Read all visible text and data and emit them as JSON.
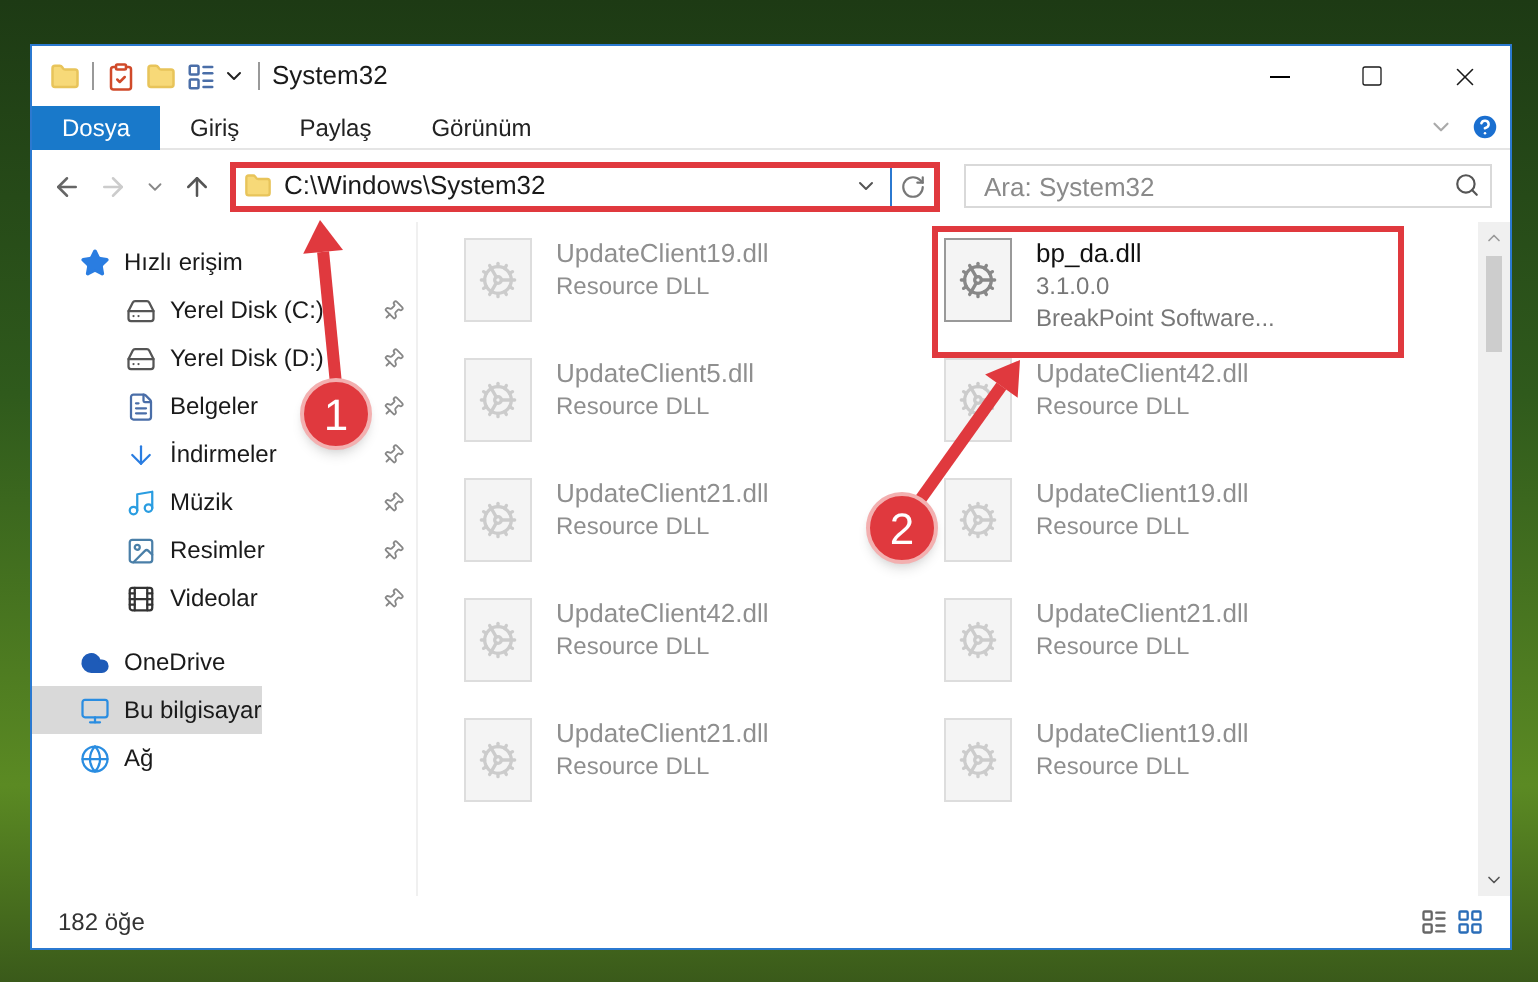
{
  "window": {
    "title": "System32"
  },
  "ribbon_tabs": [
    {
      "label": "Dosya",
      "selected": true
    },
    {
      "label": "Giriş",
      "selected": false
    },
    {
      "label": "Paylaş",
      "selected": false
    },
    {
      "label": "Görünüm",
      "selected": false
    }
  ],
  "address_bar": {
    "path": "C:\\Windows\\System32",
    "highlighted": true
  },
  "search": {
    "placeholder": "Ara: System32"
  },
  "sidebar": {
    "items": [
      {
        "label": "Hızlı erişim",
        "kind": "star",
        "selected": false,
        "children": [
          {
            "label": "Yerel Disk (C:)",
            "kind": "drive",
            "selected": false,
            "pinned": true
          },
          {
            "label": "Yerel Disk (D:)",
            "kind": "drive",
            "selected": false,
            "pinned": true
          },
          {
            "label": "Belgeler",
            "kind": "document",
            "selected": false,
            "pinned": true
          },
          {
            "label": "İndirmeler",
            "kind": "download",
            "selected": false,
            "pinned": true
          },
          {
            "label": "Müzik",
            "kind": "music",
            "selected": false,
            "pinned": true
          },
          {
            "label": "Resimler",
            "kind": "picture",
            "selected": false,
            "pinned": true
          },
          {
            "label": "Videolar",
            "kind": "video",
            "selected": false,
            "pinned": true
          }
        ]
      },
      {
        "label": "OneDrive",
        "kind": "cloud",
        "selected": false
      },
      {
        "label": "Bu bilgisayar",
        "kind": "computer",
        "selected": true
      },
      {
        "label": "Ağ",
        "kind": "network",
        "selected": false
      }
    ]
  },
  "files": [
    {
      "name": "UpdateClient19.dll",
      "details": [
        "Resource DLL"
      ],
      "blurred": true,
      "highlighted": false
    },
    {
      "name": "bp_da.dll",
      "details": [
        "3.1.0.0",
        "BreakPoint Software..."
      ],
      "blurred": false,
      "highlighted": true
    },
    {
      "name": "UpdateClient5.dll",
      "details": [
        "Resource DLL"
      ],
      "blurred": true,
      "highlighted": false
    },
    {
      "name": "UpdateClient42.dll",
      "details": [
        "Resource DLL"
      ],
      "blurred": true,
      "highlighted": false
    },
    {
      "name": "UpdateClient21.dll",
      "details": [
        "Resource DLL"
      ],
      "blurred": true,
      "highlighted": false
    },
    {
      "name": "UpdateClient19.dll",
      "details": [
        "Resource DLL"
      ],
      "blurred": true,
      "highlighted": false
    },
    {
      "name": "UpdateClient42.dll",
      "details": [
        "Resource DLL"
      ],
      "blurred": true,
      "highlighted": false
    },
    {
      "name": "UpdateClient21.dll",
      "details": [
        "Resource DLL"
      ],
      "blurred": true,
      "highlighted": false
    },
    {
      "name": "UpdateClient21.dll",
      "details": [
        "Resource DLL"
      ],
      "blurred": true,
      "highlighted": false
    },
    {
      "name": "UpdateClient19.dll",
      "details": [
        "Resource DLL"
      ],
      "blurred": true,
      "highlighted": false
    }
  ],
  "status_bar": {
    "count": "182 öğe"
  },
  "callouts": [
    {
      "number": "1"
    },
    {
      "number": "2"
    }
  ]
}
